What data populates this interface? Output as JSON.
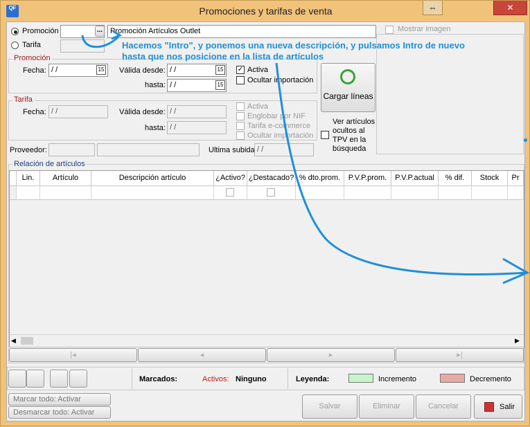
{
  "window": {
    "title": "Promociones y tarifas de venta",
    "app_icon": "QF"
  },
  "top": {
    "radio_promocion": "Promoción",
    "radio_tarifa": "Tarifa",
    "description": "Promoción Artículos Outlet",
    "ellipsis": "...",
    "mostrar_imagen": "Mostrar imagen"
  },
  "annotation": "Hacemos \"Intro\", y ponemos una nueva descripción, y pulsamos Intro de nuevo hasta que nos posicione en la lista de artículos",
  "promocion": {
    "group": "Promoción",
    "fecha_label": "Fecha:",
    "fecha": " / /",
    "valida_desde_label": "Válida desde:",
    "valida_desde": " / /",
    "hasta_label": "hasta:",
    "hasta": " / /",
    "activa": "Activa",
    "ocultar": "Ocultar importación",
    "cal": "15"
  },
  "cargar": {
    "label": "Cargar líneas"
  },
  "tarifa": {
    "group": "Tarifa",
    "fecha_label": "Fecha:",
    "fecha": " / /",
    "valida_desde_label": "Válida desde:",
    "valida_desde": " / /",
    "hasta_label": "hasta:",
    "hasta": " / /",
    "activa": "Activa",
    "englobar": "Englobar por NIF",
    "ecommerce": "Tarifa e-commerce",
    "ocultar": "Ocultar importación",
    "ver_ocultos": "Ver artículos ocultos al TPV en la búsqueda"
  },
  "proveedor": {
    "label": "Proveedor:",
    "ultima_label": "Ultima subida",
    "ultima": " / /"
  },
  "relacion": {
    "label": "Relación de artículos",
    "columns": [
      "Lin.",
      "Artículo",
      "Descripción artículo",
      "¿Activo?",
      "¿Destacado?",
      "% dto.prom.",
      "P.V.P.prom.",
      "P.V.P.actual",
      "% dif.",
      "Stock",
      "Pr"
    ]
  },
  "footer": {
    "marcados": "Marcados:",
    "activos": "Activos:",
    "ninguno": "Ninguno",
    "leyenda": "Leyenda:",
    "incremento": "Incremento",
    "decremento": "Decremento",
    "incremento_color": "#c8f5c8",
    "decremento_color": "#e8aaa5",
    "marcar_todo": "Marcar todo:  Activar",
    "desmarcar_todo": "Desmarcar todo:  Activar",
    "guardar": "Salvar",
    "eliminar": "Eliminar",
    "cancelar": "Cancelar",
    "salir": "Salir"
  }
}
